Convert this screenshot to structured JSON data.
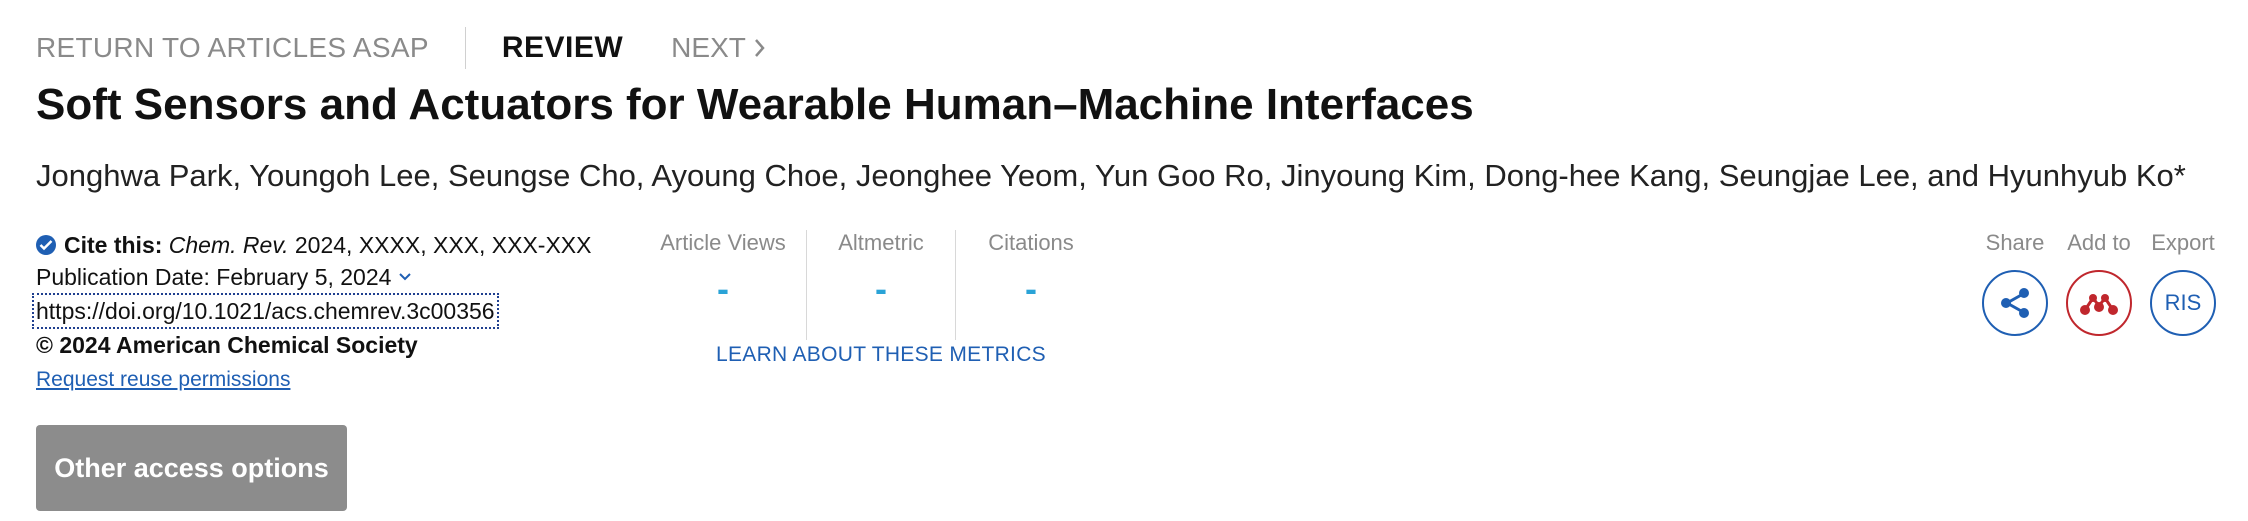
{
  "nav": {
    "back_label": "RETURN TO ARTICLES ASAP",
    "type_label": "REVIEW",
    "next_label": "NEXT"
  },
  "article": {
    "title": "Soft Sensors and Actuators for Wearable Human–Machine Interfaces",
    "authors": "Jonghwa Park, Youngoh Lee, Seungse Cho, Ayoung Choe, Jeonghee Yeom, Yun Goo Ro, Jinyoung Kim, Dong-hee Kang, Seungjae Lee, and Hyunhyub Ko*"
  },
  "cite": {
    "prefix": "Cite this:",
    "journal": "Chem. Rev.",
    "details": " 2024, XXXX, XXX, XXX-XXX",
    "pub_date": "Publication Date: February 5, 2024",
    "doi": "https://doi.org/10.1021/acs.chemrev.3c00356",
    "copyright": "© 2024 American Chemical Society",
    "reuse_link": "Request reuse permissions"
  },
  "access_button": "Other access options",
  "metrics": [
    {
      "label": "Article Views",
      "value": "-"
    },
    {
      "label": "Altmetric",
      "value": "-"
    },
    {
      "label": "Citations",
      "value": "-"
    }
  ],
  "metrics_link": "LEARN ABOUT THESE METRICS",
  "actions": [
    {
      "label": "Share",
      "icon": "share-icon"
    },
    {
      "label": "Add to",
      "icon": "mendeley-icon"
    },
    {
      "label": "Export",
      "icon": "ris-icon",
      "text": "RIS"
    }
  ],
  "colors": {
    "accent_blue": "#1f5fb3",
    "metric_blue": "#2aa3d7",
    "mendeley_red": "#c0272d",
    "button_gray": "#8c8c8c"
  }
}
